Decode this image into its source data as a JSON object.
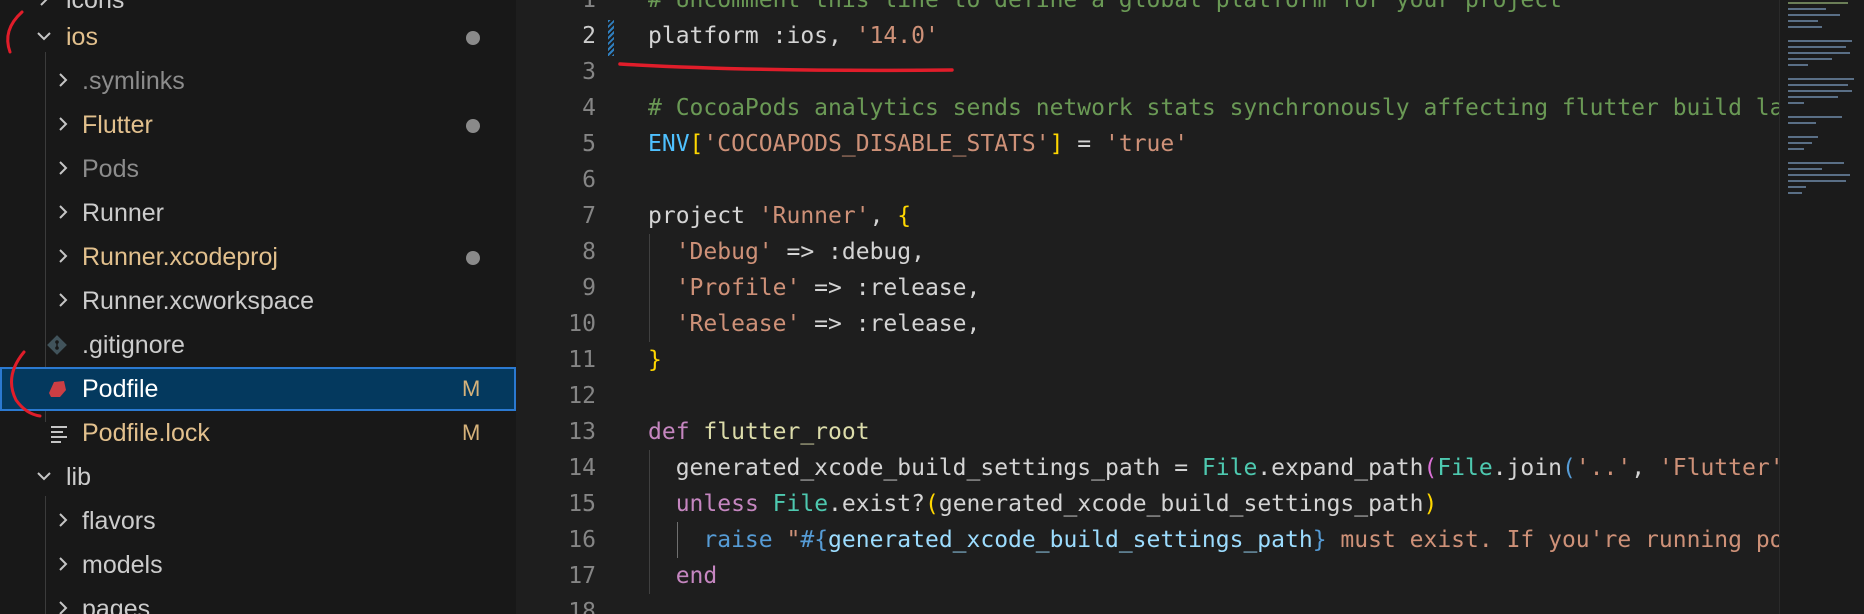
{
  "explorer": {
    "top_partial_label": "icons",
    "items": [
      {
        "label": "ios",
        "color": "#e2c08d",
        "dot": true
      },
      {
        "label": ".symlinks",
        "color": "#8c8c8c"
      },
      {
        "label": "Flutter",
        "color": "#e2c08d",
        "dot": true
      },
      {
        "label": "Pods",
        "color": "#8c8c8c"
      },
      {
        "label": "Runner",
        "color": "#cccccc"
      },
      {
        "label": "Runner.xcodeproj",
        "color": "#e2c08d",
        "dot": true
      },
      {
        "label": "Runner.xcworkspace",
        "color": "#cccccc"
      },
      {
        "label": ".gitignore",
        "color": "#cccccc",
        "icon": "git-icon"
      },
      {
        "label": "Podfile",
        "color": "#ffffff",
        "badge": "M",
        "icon": "ruby-icon",
        "selected": true
      },
      {
        "label": "Podfile.lock",
        "color": "#e2c08d",
        "badge": "M",
        "icon": "lines-icon"
      },
      {
        "label": "lib",
        "color": "#cccccc"
      },
      {
        "label": "flavors",
        "color": "#cccccc"
      },
      {
        "label": "models",
        "color": "#cccccc"
      },
      {
        "label": "pages",
        "color": "#cccccc"
      }
    ]
  },
  "editor": {
    "line_numbers": [
      "1",
      "2",
      "3",
      "4",
      "5",
      "6",
      "7",
      "8",
      "9",
      "10",
      "11",
      "12",
      "13",
      "14",
      "15",
      "16",
      "17",
      "18"
    ],
    "active_line": "2",
    "tokens": {
      "l1": "# Uncomment this line to define a global platform for your project",
      "l2a": "platform :ios, ",
      "l2b": "'14.0'",
      "l4": "# CocoaPods analytics sends network stats synchronously affecting flutter build latency.",
      "l5a": "ENV",
      "l5b": "[",
      "l5c": "'COCOAPODS_DISABLE_STATS'",
      "l5d": "]",
      "l5e": " = ",
      "l5f": "'true'",
      "l7a": "project ",
      "l7b": "'Runner'",
      "l7c": ", ",
      "l7d": "{",
      "l8a": "'Debug'",
      "l8b": " => :debug,",
      "l9a": "'Profile'",
      "l9b": " => :release,",
      "l10a": "'Release'",
      "l10b": " => :release,",
      "l11": "}",
      "l13a": "def",
      "l13b": " flutter_root",
      "l14a": "generated_xcode_build_settings_path = ",
      "l14b": "File",
      "l14c": ".expand_path",
      "l14d": "(",
      "l14e": "File",
      "l14f": ".join",
      "l14g": "(",
      "l14h": "'..'",
      "l14i": ", ",
      "l14j": "'Flutter', 'Generated.xcconfig'",
      "l15a": "unless",
      "l15b": " ",
      "l15c": "File",
      "l15d": ".exist?",
      "l15e": "(",
      "l15f": "generated_xcode_build_settings_path",
      "l15g": ")",
      "l16a": "raise",
      "l16b": " \"",
      "l16c": "#{",
      "l16d": "generated_xcode_build_settings_path",
      "l16e": "}",
      "l16f": " must exist. If you're running pod install manually, make sure flutter pub get is executed first\"",
      "l17": "end"
    }
  },
  "colors": {
    "annotation_red": "#e11d2a",
    "selection_bg": "#04395e",
    "selection_border": "#2b79d1"
  }
}
